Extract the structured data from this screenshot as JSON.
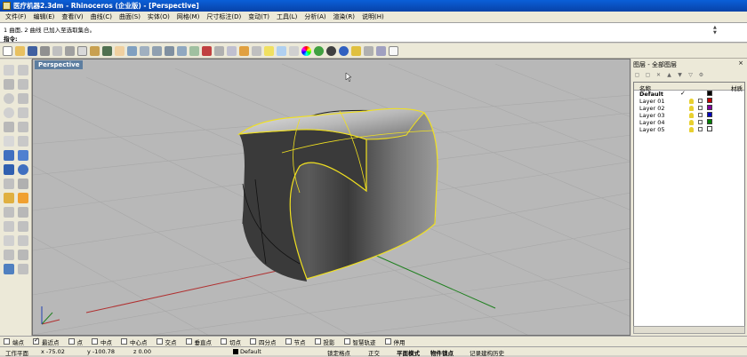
{
  "window": {
    "title": "医疗机器2.3dm - Rhinoceros (企业版) - [Perspective]"
  },
  "menu": [
    "文件(F)",
    "编辑(E)",
    "查看(V)",
    "曲线(C)",
    "曲面(S)",
    "实体(O)",
    "网格(M)",
    "尺寸标注(D)",
    "变动(T)",
    "工具(L)",
    "分析(A)",
    "渲染(R)",
    "说明(H)"
  ],
  "command": {
    "history": "1 曲面, 2 曲线 已加入至选取集合。",
    "prompt": "指令: "
  },
  "viewport": {
    "label": "Perspective"
  },
  "layers_panel": {
    "title": "图层 - 全部图层",
    "close": "×",
    "col_name": "名称",
    "col_material": "材质",
    "layers": [
      {
        "name": "Default",
        "current": "✓",
        "color": "#000000"
      },
      {
        "name": "Layer 01",
        "current": "",
        "color": "#c00000"
      },
      {
        "name": "Layer 02",
        "current": "",
        "color": "#8000a0"
      },
      {
        "name": "Layer 03",
        "current": "",
        "color": "#0000c0"
      },
      {
        "name": "Layer 04",
        "current": "",
        "color": "#008000"
      },
      {
        "name": "Layer 05",
        "current": "",
        "color": "#ffffff"
      }
    ]
  },
  "osnap": [
    {
      "label": "端点",
      "checked": false
    },
    {
      "label": "最近点",
      "checked": true
    },
    {
      "label": "点",
      "checked": false
    },
    {
      "label": "中点",
      "checked": false
    },
    {
      "label": "中心点",
      "checked": false
    },
    {
      "label": "交点",
      "checked": false
    },
    {
      "label": "垂直点",
      "checked": false
    },
    {
      "label": "切点",
      "checked": false
    },
    {
      "label": "四分点",
      "checked": false
    },
    {
      "label": "节点",
      "checked": false
    },
    {
      "label": "投影",
      "checked": false
    },
    {
      "label": "智慧轨迹",
      "checked": false
    },
    {
      "label": "停用",
      "checked": false
    }
  ],
  "status": {
    "cplane": "工作平面",
    "x": "x -75.02",
    "y": "y -100.78",
    "z": "z 0.00",
    "layer": "Default",
    "snap": "锁定格点",
    "ortho": "正交",
    "planar": "平面模式",
    "objsnap": "物件锁点",
    "history": "记录建构历史"
  }
}
